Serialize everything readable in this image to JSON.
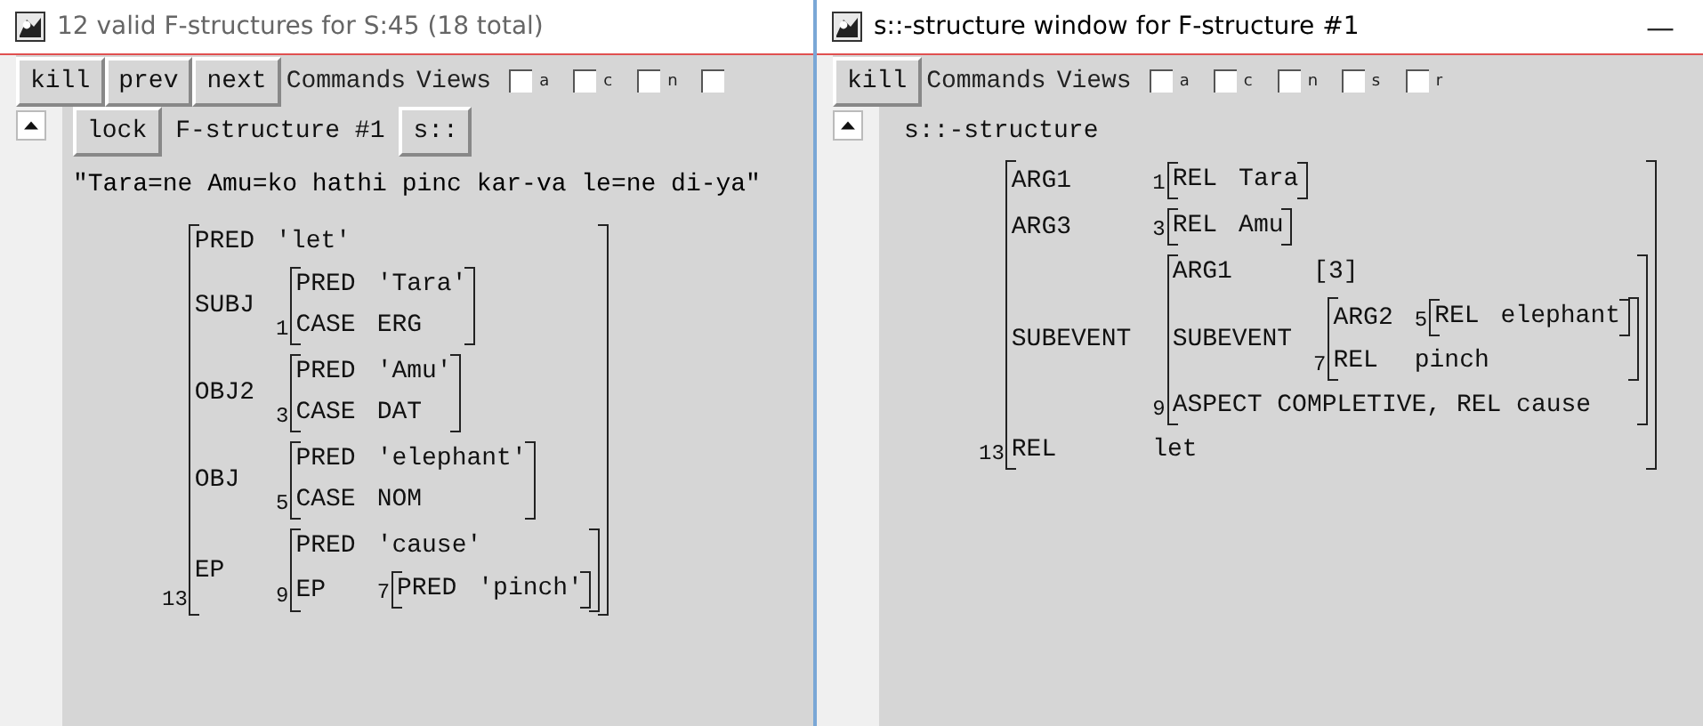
{
  "windows": [
    {
      "title": "12 valid F-structures for S:45 (18 total)",
      "active": false,
      "toolbar": {
        "buttons": [
          "kill",
          "prev",
          "next"
        ],
        "menus": [
          "Commands",
          "Views"
        ],
        "checkboxes": [
          {
            "label": "a",
            "checked": false
          },
          {
            "label": "c",
            "checked": false
          },
          {
            "label": "n",
            "checked": false
          },
          {
            "checked": false
          }
        ]
      },
      "header": [
        {
          "kind": "button",
          "text": "lock"
        },
        {
          "kind": "label",
          "text": "F-structure #1"
        },
        {
          "kind": "button",
          "text": "s::"
        }
      ],
      "sentence": "\"Tara=ne Amu=ko hathi pinc kar-va le=ne di-ya\"",
      "structure": {
        "index": "13",
        "rows": [
          {
            "kind": "atom",
            "attr": "PRED",
            "value": "'let'"
          },
          {
            "kind": "matrix",
            "attr": "SUBJ",
            "value": {
              "index": "1",
              "rows": [
                {
                  "kind": "atom",
                  "attr": "PRED",
                  "value": "'Tara'"
                },
                {
                  "kind": "atom",
                  "attr": "CASE",
                  "value": "ERG"
                }
              ]
            }
          },
          {
            "kind": "matrix",
            "attr": "OBJ2",
            "value": {
              "index": "3",
              "rows": [
                {
                  "kind": "atom",
                  "attr": "PRED",
                  "value": "'Amu'"
                },
                {
                  "kind": "atom",
                  "attr": "CASE",
                  "value": "DAT"
                }
              ]
            }
          },
          {
            "kind": "matrix",
            "attr": "OBJ",
            "value": {
              "index": "5",
              "rows": [
                {
                  "kind": "atom",
                  "attr": "PRED",
                  "value": "'elephant'"
                },
                {
                  "kind": "atom",
                  "attr": "CASE",
                  "value": "NOM"
                }
              ]
            }
          },
          {
            "kind": "matrix",
            "attr": "EP",
            "value": {
              "index": "9",
              "rows": [
                {
                  "kind": "atom",
                  "attr": "PRED",
                  "value": "'cause'"
                },
                {
                  "kind": "matrix",
                  "attr": "EP",
                  "value": {
                    "index": "7",
                    "rows": [
                      {
                        "kind": "atom",
                        "attr": "PRED",
                        "value": "'pinch'"
                      }
                    ]
                  }
                }
              ]
            }
          }
        ]
      }
    },
    {
      "title": "s::-structure window for F-structure #1",
      "active": true,
      "minimize": "—",
      "toolbar": {
        "buttons": [
          "kill"
        ],
        "menus": [
          "Commands",
          "Views"
        ],
        "checkboxes": [
          {
            "label": "a",
            "checked": false
          },
          {
            "label": "c",
            "checked": false
          },
          {
            "label": "n",
            "checked": false
          },
          {
            "label": "s",
            "checked": false
          },
          {
            "label": "r",
            "checked": false
          }
        ]
      },
      "header": [
        {
          "kind": "label",
          "text": "s::-structure"
        }
      ],
      "structure": {
        "index": "13",
        "rows": [
          {
            "kind": "matrix",
            "attr": "ARG1",
            "value": {
              "index": "1",
              "rows": [
                {
                  "kind": "atom",
                  "attr": "REL",
                  "value": "Tara"
                }
              ]
            }
          },
          {
            "kind": "matrix",
            "attr": "ARG3",
            "value": {
              "index": "3",
              "rows": [
                {
                  "kind": "atom",
                  "attr": "REL",
                  "value": "Amu"
                }
              ]
            }
          },
          {
            "kind": "matrix",
            "attr": "SUBEVENT",
            "value": {
              "index": "9",
              "rows": [
                {
                  "kind": "atom",
                  "attr": "ARG1",
                  "value": "[3]"
                },
                {
                  "kind": "matrix",
                  "attr": "SUBEVENT",
                  "value": {
                    "index": "7",
                    "rows": [
                      {
                        "kind": "matrix",
                        "attr": "ARG2",
                        "value": {
                          "index": "5",
                          "rows": [
                            {
                              "kind": "atom",
                              "attr": "REL",
                              "value": "elephant"
                            }
                          ]
                        }
                      },
                      {
                        "kind": "atom",
                        "attr": "REL",
                        "value": "pinch"
                      }
                    ]
                  }
                },
                {
                  "kind": "line",
                  "text": "ASPECT COMPLETIVE, REL cause"
                }
              ]
            }
          },
          {
            "kind": "atom",
            "attr": "REL",
            "value": "let"
          }
        ]
      }
    }
  ]
}
